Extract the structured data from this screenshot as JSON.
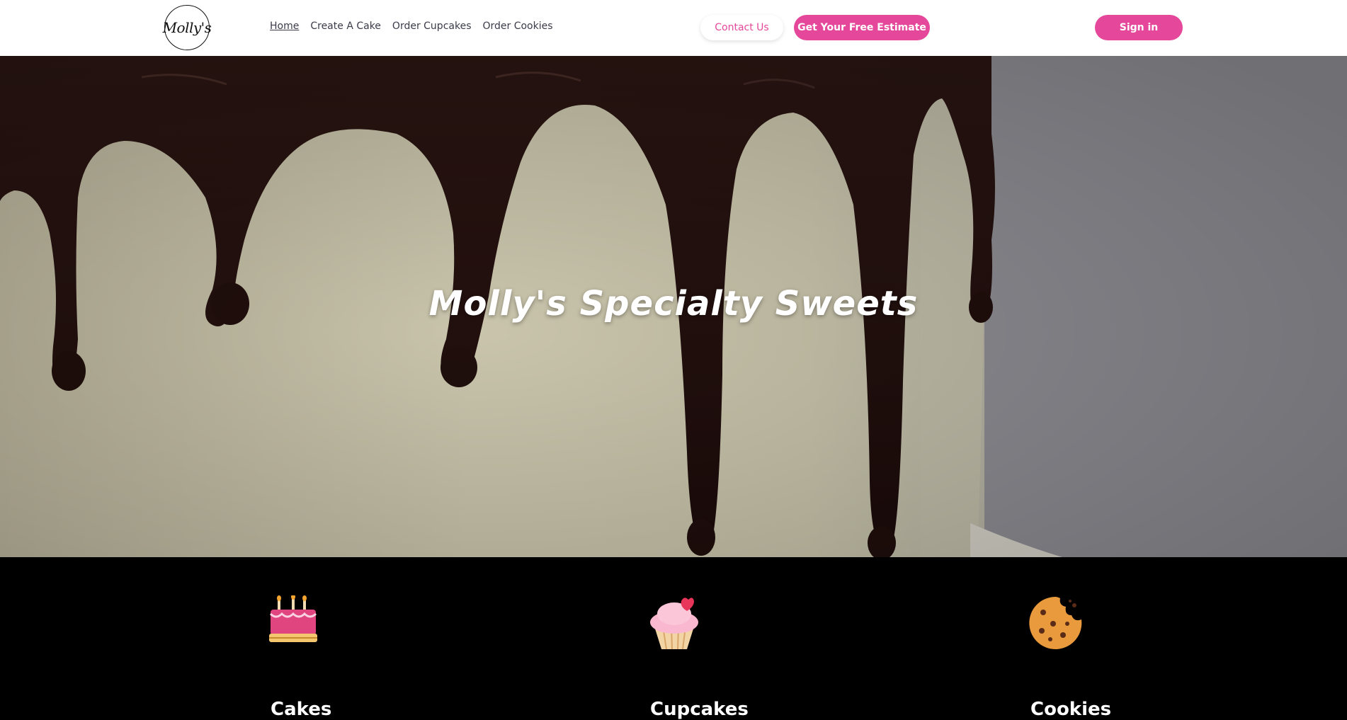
{
  "header": {
    "logo_text": "Molly's",
    "nav": [
      {
        "label": "Home",
        "active": true
      },
      {
        "label": "Create A Cake",
        "active": false
      },
      {
        "label": "Order Cupcakes",
        "active": false
      },
      {
        "label": "Order Cookies",
        "active": false
      }
    ],
    "contact_label": "Contact Us",
    "estimate_label": "Get Your Free Estimate",
    "signin_label": "Sign in"
  },
  "hero": {
    "title": "Molly's Specialty Sweets"
  },
  "categories": [
    {
      "icon": "cake-icon",
      "label": "Cakes"
    },
    {
      "icon": "cupcake-icon",
      "label": "Cupcakes"
    },
    {
      "icon": "cookie-icon",
      "label": "Cookies"
    }
  ],
  "colors": {
    "accent": "#e5489a",
    "header_bg": "#ffffff",
    "footer_bg": "#000000",
    "nav_text": "#3b3b4a"
  }
}
